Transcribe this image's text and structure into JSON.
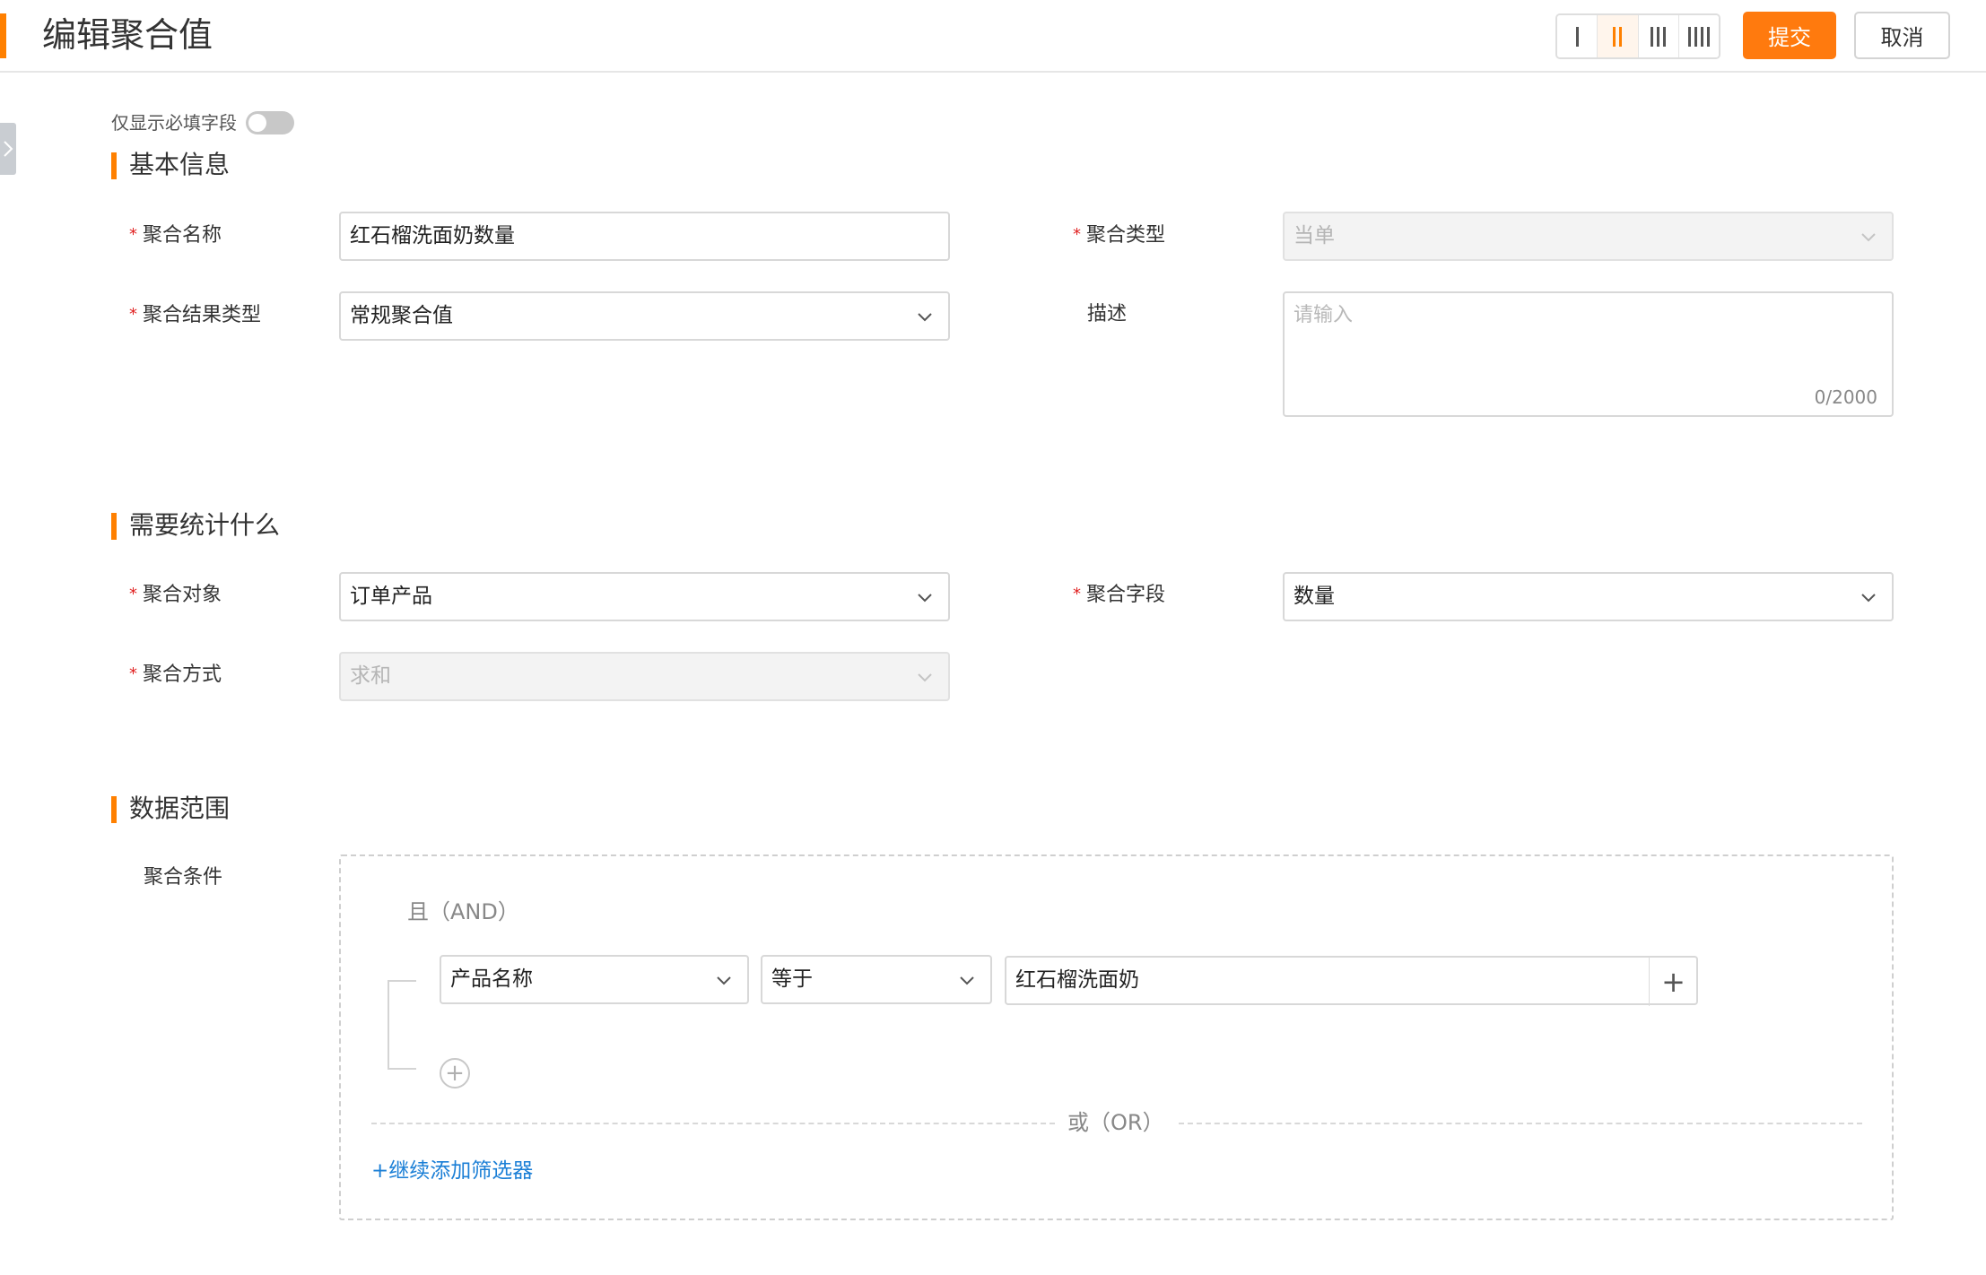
{
  "header": {
    "title": "编辑聚合值",
    "submit_label": "提交",
    "cancel_label": "取消",
    "layout_options": [
      "1-column",
      "2-column",
      "3-column",
      "4-column"
    ],
    "active_layout": "2-column",
    "accent_color": "#ff8000"
  },
  "required_only": {
    "label": "仅显示必填字段",
    "enabled": false
  },
  "sections": {
    "basic": "基本信息",
    "stats": "需要统计什么",
    "scope": "数据范围"
  },
  "basic": {
    "agg_name": {
      "label": "聚合名称",
      "value": "红石榴洗面奶数量",
      "required": true
    },
    "agg_type": {
      "label": "聚合类型",
      "value": "当单",
      "required": true,
      "disabled": true
    },
    "result_type": {
      "label": "聚合结果类型",
      "value": "常规聚合值",
      "required": true
    },
    "description": {
      "label": "描述",
      "placeholder": "请输入",
      "count": "0/2000"
    }
  },
  "stats": {
    "agg_object": {
      "label": "聚合对象",
      "value": "订单产品",
      "required": true
    },
    "agg_field": {
      "label": "聚合字段",
      "value": "数量",
      "required": true
    },
    "agg_method": {
      "label": "聚合方式",
      "value": "求和",
      "required": true,
      "disabled": true
    }
  },
  "scope": {
    "condition_label": "聚合条件",
    "and_label": "且（AND）",
    "or_label": "或（OR）",
    "filter": {
      "field": "产品名称",
      "operator": "等于",
      "value": "红石榴洗面奶"
    },
    "add_filter_label": "+继续添加筛选器"
  }
}
